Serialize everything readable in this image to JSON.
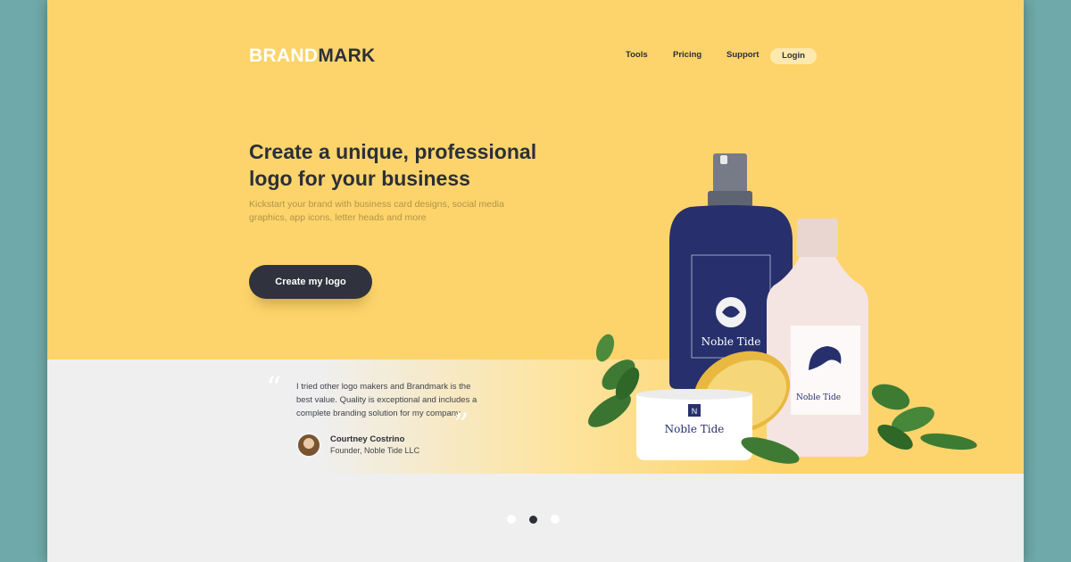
{
  "header": {
    "brand_part1": "BRAND",
    "brand_part2": "MARK",
    "nav": [
      "Tools",
      "Pricing",
      "Support"
    ],
    "login": "Login"
  },
  "hero": {
    "headline": "Create a unique, professional logo for your business",
    "subtext": "Kickstart your brand with business card designs, social media graphics, app icons, letter heads and more",
    "cta": "Create my logo"
  },
  "product": {
    "brand": "Noble Tide"
  },
  "testimonial": {
    "quote": "I tried other logo makers and Brandmark is the best value. Quality is exceptional and includes a complete branding solution for my company",
    "author": "Courtney Costrino",
    "role": "Founder, Noble Tide LLC"
  },
  "carousel": {
    "dot_count": 3,
    "active_index": 1
  },
  "colors": {
    "hero_bg": "#fdd46b",
    "dark": "#2c2f38",
    "bottle_navy": "#27306d",
    "outer_bg": "#6fa9a9"
  }
}
